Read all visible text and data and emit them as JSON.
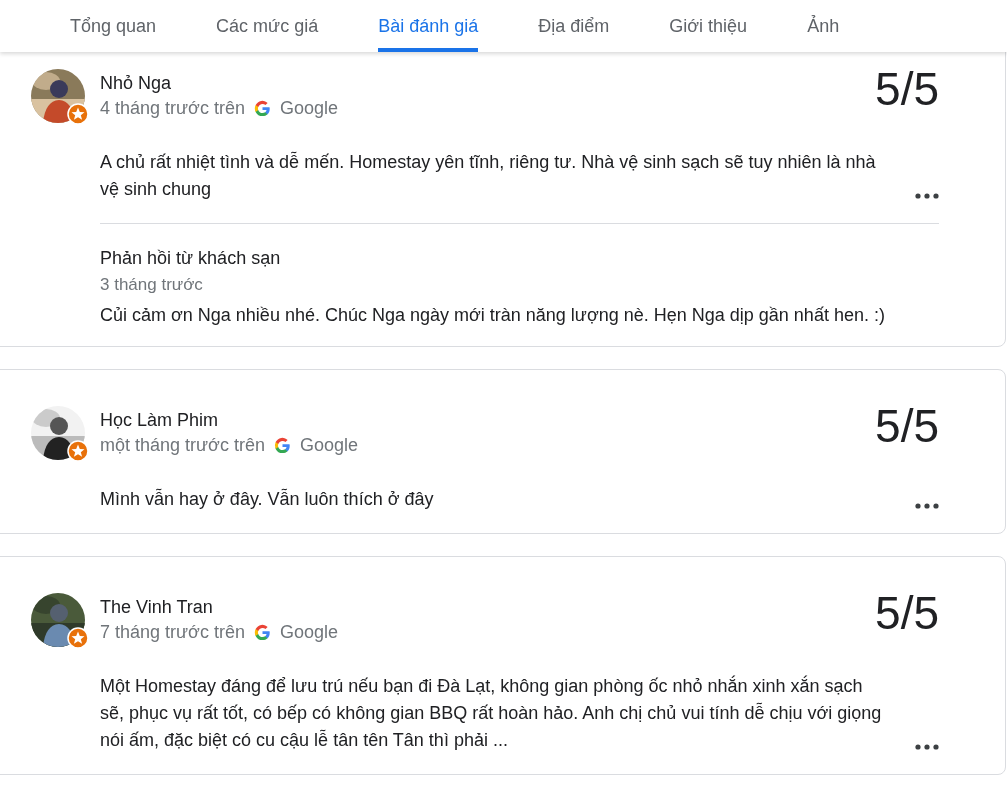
{
  "tabs": [
    {
      "label": "Tổng quan",
      "selected": false
    },
    {
      "label": "Các mức giá",
      "selected": false
    },
    {
      "label": "Bài đánh giá",
      "selected": true
    },
    {
      "label": "Địa điểm",
      "selected": false
    },
    {
      "label": "Giới thiệu",
      "selected": false
    },
    {
      "label": "Ảnh",
      "selected": false
    }
  ],
  "reviews": [
    {
      "name": "Nhỏ Nga",
      "time": "4 tháng trước trên",
      "source": "Google",
      "score": "5/5",
      "text": "A chủ rất nhiệt tình và dễ mến. Homestay yên tĩnh, riêng tư. Nhà vệ sinh sạch sẽ tuy nhiên là nhà vệ sinh chung",
      "response": {
        "title": "Phản hồi từ khách sạn",
        "time": "3 tháng trước",
        "text": "Củi cảm ơn Nga nhiều nhé. Chúc Nga ngày mới tràn năng lượng nè. Hẹn Nga dịp gần nhất hen. :)"
      }
    },
    {
      "name": "Học Làm Phim",
      "time": "một tháng trước trên",
      "source": "Google",
      "score": "5/5",
      "text": "Mình vẫn hay ở đây. Vẫn luôn thích ở đây"
    },
    {
      "name": "The Vinh Tran",
      "time": "7 tháng trước trên",
      "source": "Google",
      "score": "5/5",
      "text": "Một Homestay đáng để lưu trú nếu bạn đi Đà Lạt, không gian phòng ốc nhỏ nhắn xinh xắn sạch sẽ, phục vụ rất tốt, có bếp có không gian BBQ rất hoàn hảo. Anh chị chủ vui tính dễ chịu với giọng nói ấm, đặc biệt có cu cậu lễ tân tên Tân thì phải ..."
    }
  ]
}
